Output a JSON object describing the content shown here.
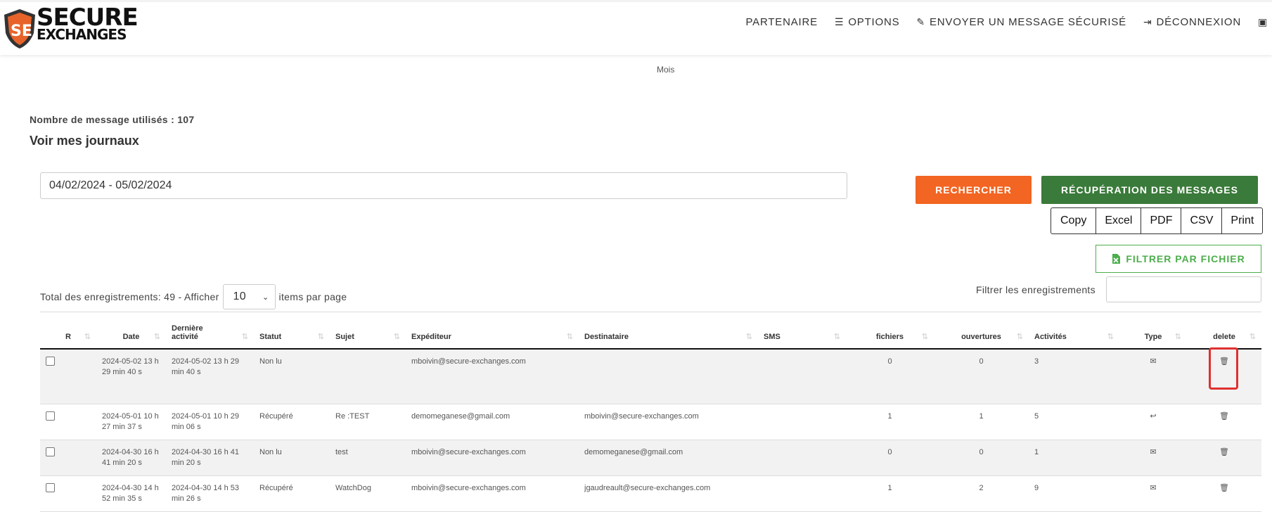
{
  "header": {
    "logo_line1": "SECURE",
    "logo_line2": "EXCHANGES",
    "nav": [
      {
        "label": "PARTENAIRE",
        "icon": ""
      },
      {
        "label": "OPTIONS",
        "icon": "menu-icon"
      },
      {
        "label": "ENVOYER UN MESSAGE SÉCURISÉ",
        "icon": "edit-icon"
      },
      {
        "label": "DÉCONNEXION",
        "icon": "sign-out-icon"
      },
      {
        "label": "",
        "icon": "id-card-icon"
      }
    ]
  },
  "mois": "Mois",
  "count_text": "Nombre de message utilisés : 107",
  "journaux_title": "Voir mes journaux",
  "daterange_value": "04/02/2024 - 05/02/2024",
  "buttons": {
    "rechercher": "RECHERCHER",
    "recuperation": "RÉCUPÉRATION DES MESSAGES",
    "filtrer_fichier": "FILTRER PAR FICHIER"
  },
  "export_buttons": [
    "Copy",
    "Excel",
    "PDF",
    "CSV",
    "Print"
  ],
  "pagination": {
    "total_text": "Total des enregistrements: 49 - Afficher",
    "per_page": "10",
    "items_text": "items par page"
  },
  "filter_label": "Filtrer les enregistrements",
  "table": {
    "columns": [
      "R",
      "Date",
      "Dernière activité",
      "Statut",
      "Sujet",
      "Expéditeur",
      "Destinataire",
      "SMS",
      "fichiers",
      "ouvertures",
      "Activités",
      "Type",
      "delete"
    ],
    "rows": [
      {
        "date": "2024-05-02 13 h 29 min 40 s",
        "last": "2024-05-02 13 h 29 min 40 s",
        "statut": "Non lu",
        "sujet": "",
        "exp": "mboivin@secure-exchanges.com",
        "dest": "",
        "sms": "",
        "fichiers": "0",
        "ouvertures": "0",
        "activites": "3",
        "type_icon": "envelope-icon"
      },
      {
        "date": "2024-05-01 10 h 27 min 37 s",
        "last": "2024-05-01 10 h 29 min 06 s",
        "statut": "Récupéré",
        "sujet": "Re :TEST",
        "exp": "demomeganese@gmail.com",
        "dest": "mboivin@secure-exchanges.com",
        "sms": "",
        "fichiers": "1",
        "ouvertures": "1",
        "activites": "5",
        "type_icon": "reply-icon"
      },
      {
        "date": "2024-04-30 16 h 41 min 20 s",
        "last": "2024-04-30 16 h 41 min 20 s",
        "statut": "Non lu",
        "sujet": "test",
        "exp": "mboivin@secure-exchanges.com",
        "dest": "demomeganese@gmail.com",
        "sms": "",
        "fichiers": "0",
        "ouvertures": "0",
        "activites": "1",
        "type_icon": "envelope-icon"
      },
      {
        "date": "2024-04-30 14 h 52 min 35 s",
        "last": "2024-04-30 14 h 53 min 26 s",
        "statut": "Récupéré",
        "sujet": "WatchDog",
        "exp": "mboivin@secure-exchanges.com",
        "dest": "jgaudreault@secure-exchanges.com",
        "sms": "",
        "fichiers": "1",
        "ouvertures": "2",
        "activites": "9",
        "type_icon": "envelope-icon"
      }
    ]
  },
  "colors": {
    "orange": "#f26522",
    "green": "#3a7a3a",
    "light_green": "#4cae4c",
    "highlight": "#e03030"
  }
}
